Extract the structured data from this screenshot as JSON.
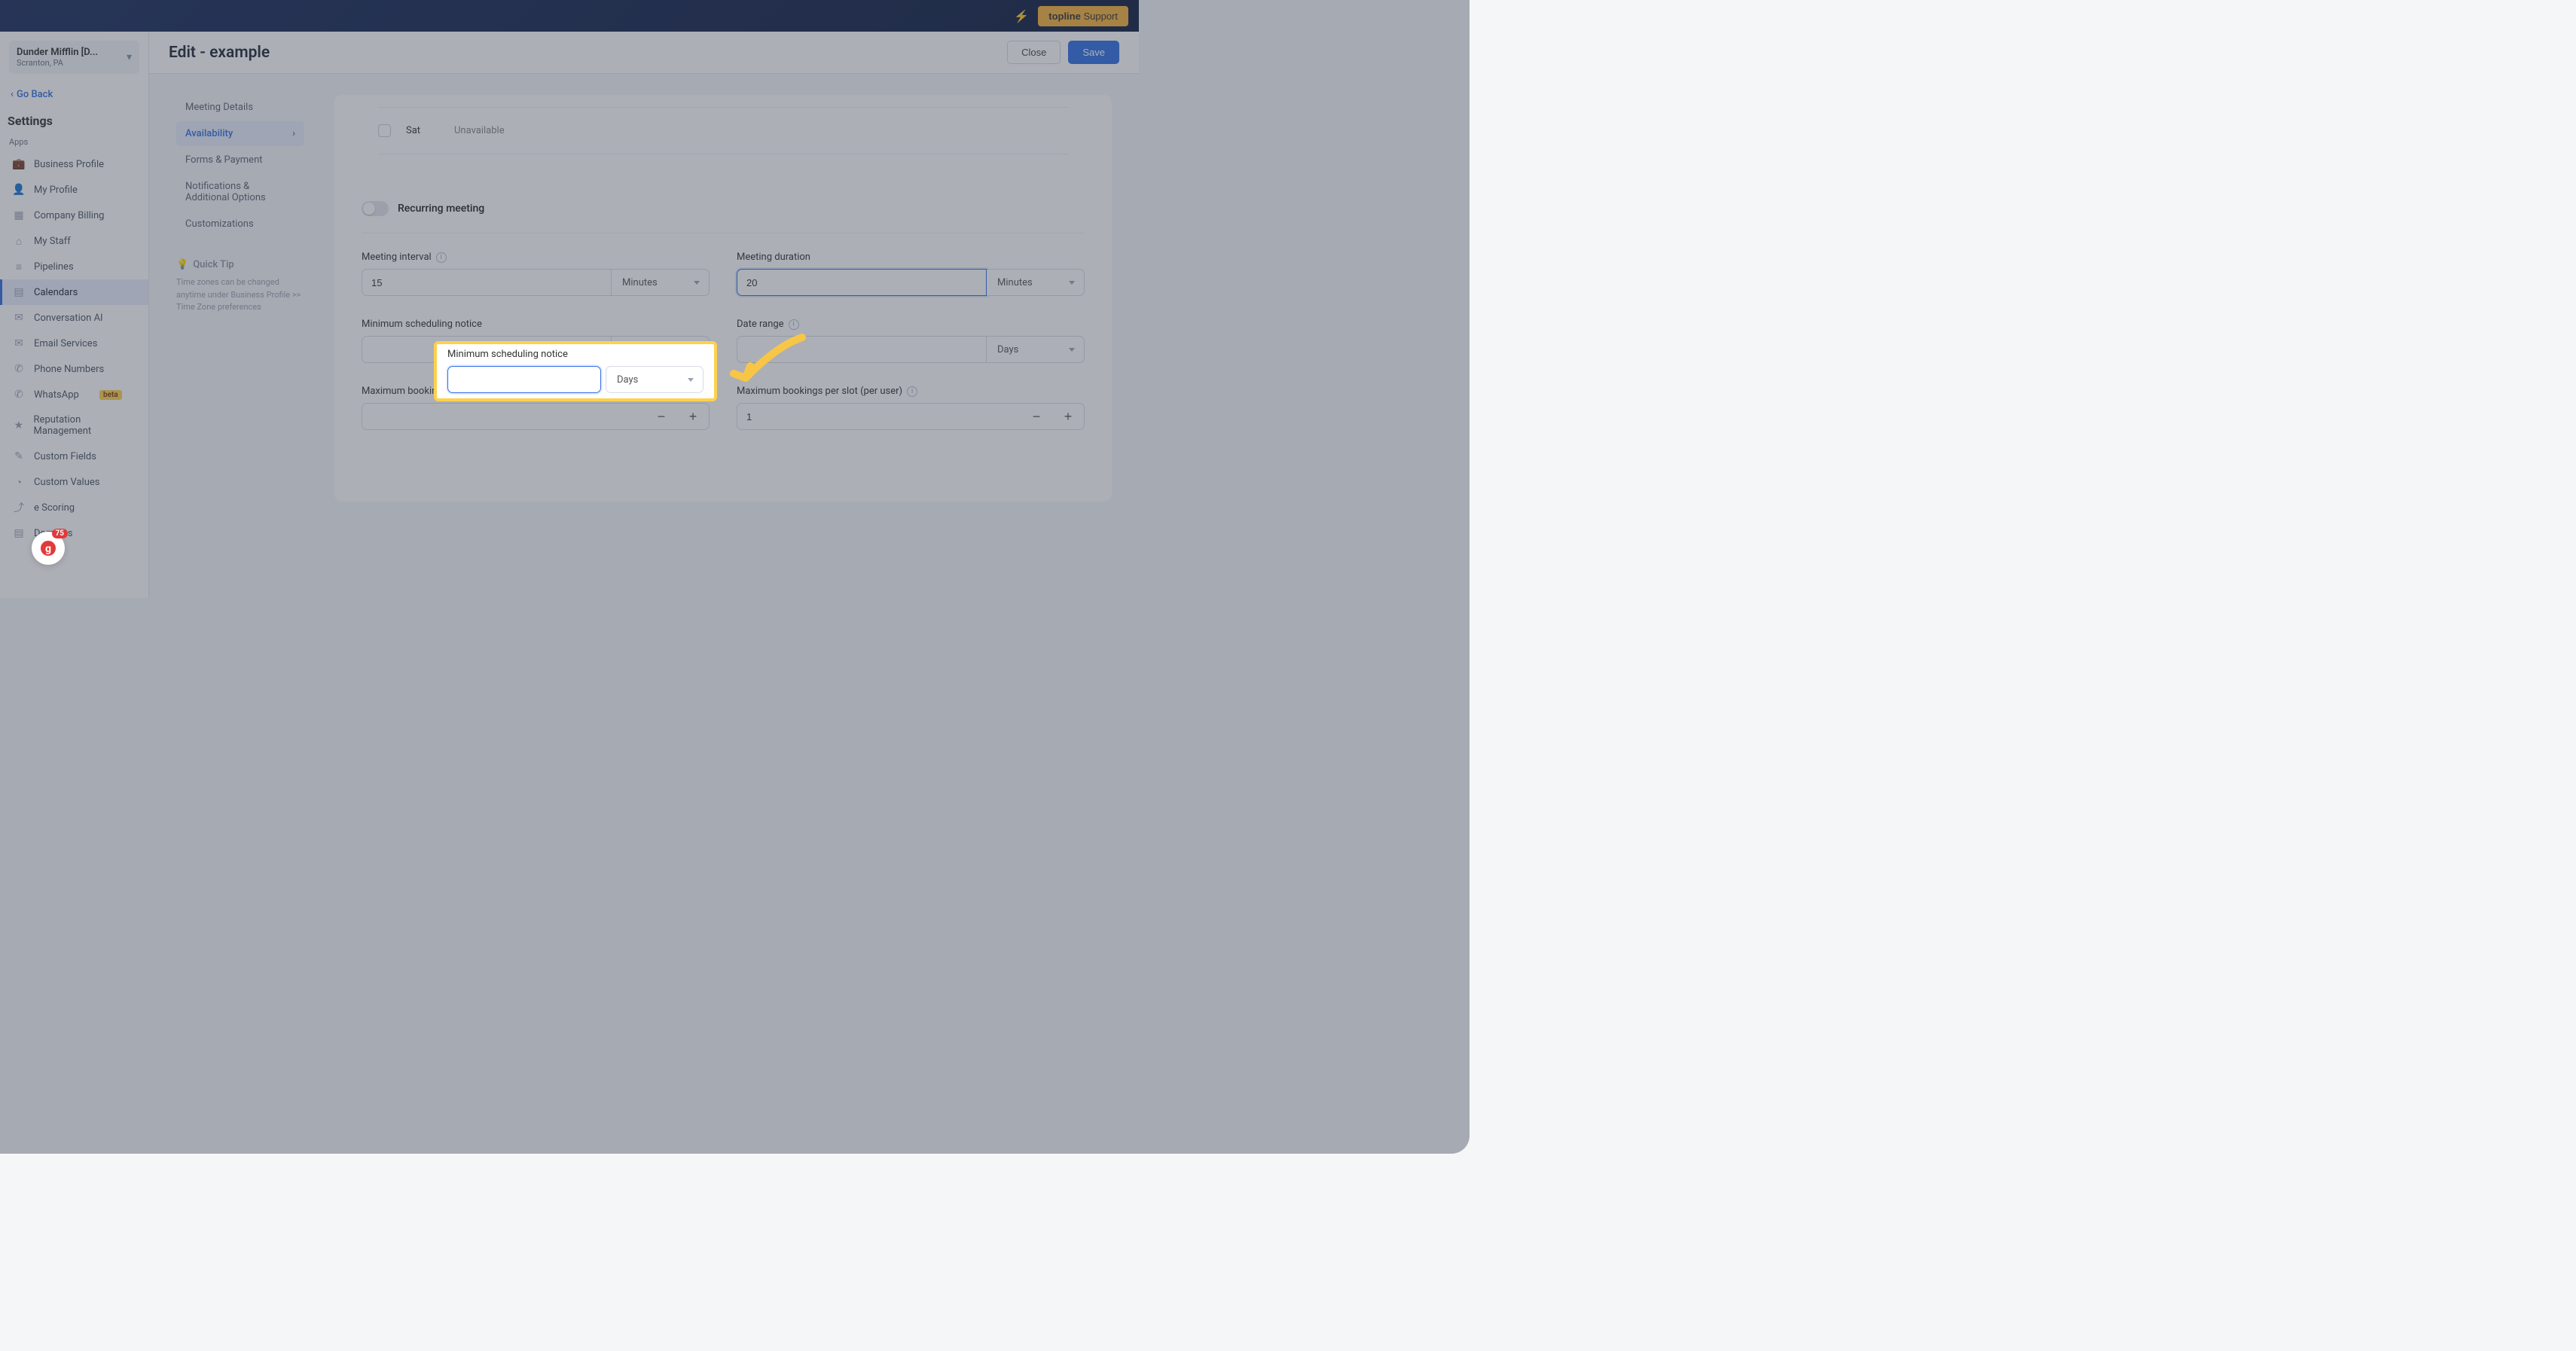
{
  "topbar": {
    "bolt": "⚡",
    "support_prefix": "topline",
    "support_label": " Support"
  },
  "org": {
    "name": "Dunder Mifflin [D...",
    "sub": "Scranton, PA"
  },
  "navigation": {
    "go_back": "Go Back",
    "settings_title": "Settings",
    "section_apps": "Apps",
    "items": [
      {
        "label": "Business Profile",
        "icon": "💼"
      },
      {
        "label": "My Profile",
        "icon": "👤"
      },
      {
        "label": "Company Billing",
        "icon": "▦"
      },
      {
        "label": "My Staff",
        "icon": "⌂"
      },
      {
        "label": "Pipelines",
        "icon": "≡"
      },
      {
        "label": "Calendars",
        "icon": "▤"
      },
      {
        "label": "Conversation AI",
        "icon": "✉"
      },
      {
        "label": "Email Services",
        "icon": "✉"
      },
      {
        "label": "Phone Numbers",
        "icon": "✆"
      },
      {
        "label": "WhatsApp",
        "icon": "✆",
        "badge": "beta"
      },
      {
        "label": "Reputation Management",
        "icon": "★"
      },
      {
        "label": "Custom Fields",
        "icon": "✎"
      },
      {
        "label": "Custom Values",
        "icon": "◔"
      },
      {
        "label": "e Scoring",
        "icon": "⤴"
      },
      {
        "label": "Domains",
        "icon": "▤"
      }
    ]
  },
  "page": {
    "title": "Edit - example",
    "close": "Close",
    "save": "Save"
  },
  "tabs": [
    "Meeting Details",
    "Availability",
    "Forms & Payment",
    "Notifications & Additional Options",
    "Customizations"
  ],
  "tip": {
    "title": "Quick Tip",
    "body": "Time zones can be changed anytime under Business Profile >> Time Zone preferences"
  },
  "availability": {
    "sat_label": "Sat",
    "sat_status": "Unavailable",
    "recurring_label": "Recurring meeting",
    "meeting_interval_label": "Meeting interval",
    "meeting_interval_value": "15",
    "meeting_interval_unit": "Minutes",
    "meeting_duration_label": "Meeting duration",
    "meeting_duration_value": "20",
    "meeting_duration_unit": "Minutes",
    "min_notice_label": "Minimum scheduling notice",
    "min_notice_value": "",
    "min_notice_unit": "Days",
    "date_range_label": "Date range",
    "date_range_value": "",
    "date_range_unit": "Days",
    "max_per_day_label": "Maximum bookings per day",
    "max_per_slot_label": "Maximum bookings per slot (per user)",
    "max_per_slot_value": "1"
  },
  "guru": {
    "count": "75"
  }
}
